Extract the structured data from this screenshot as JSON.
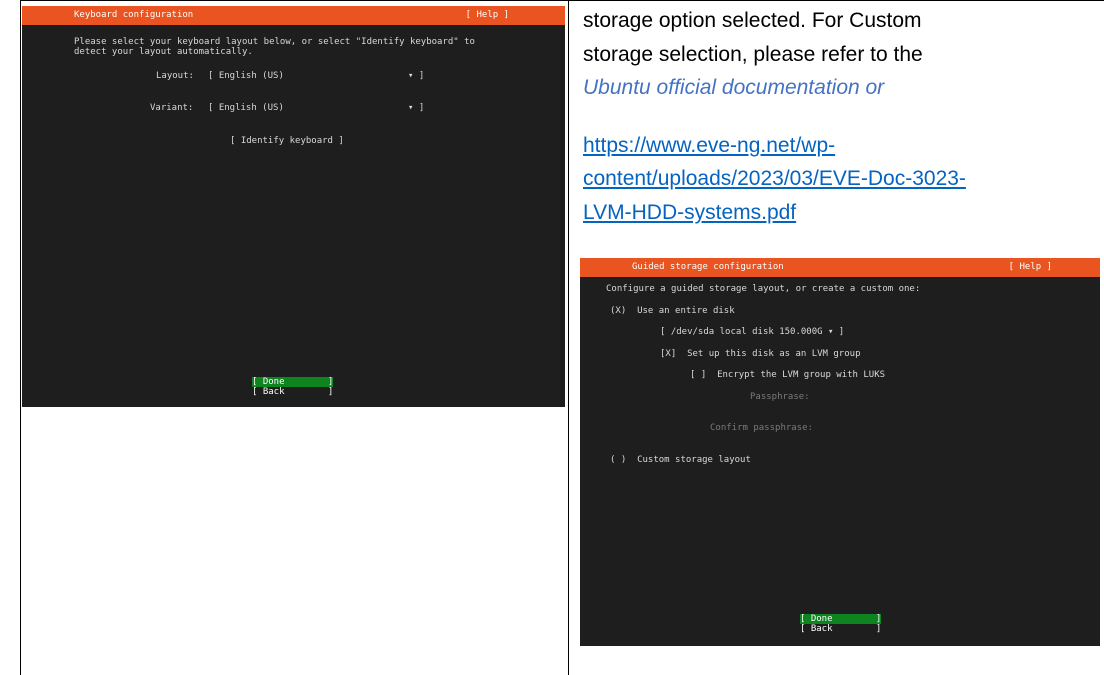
{
  "keyboard_screen": {
    "title": "Keyboard configuration",
    "help": "[ Help ]",
    "intro_line1": "Please select your keyboard layout below, or select \"Identify keyboard\" to",
    "intro_line2": "detect your layout automatically.",
    "layout_label": "Layout:",
    "layout_value": "[ English (US)",
    "layout_arrow": "▾ ]",
    "variant_label": "Variant:",
    "variant_value": "[ English (US)",
    "variant_arrow": "▾ ]",
    "identify_button": "[ Identify keyboard ]",
    "done_button": "[ Done        ]",
    "back_button": "[ Back        ]"
  },
  "doc_text": {
    "line1": "storage option selected. For Custom",
    "line2": "storage selection, please refer to the",
    "line3": "Ubuntu official documentation or",
    "link_line1": "https://www.eve-ng.net/wp-",
    "link_line2": "content/uploads/2023/03/EVE-Doc-3023-",
    "link_line3": "LVM-HDD-systems.pdf"
  },
  "storage_screen": {
    "title": "Guided storage configuration",
    "help": "[ Help ]",
    "intro": "Configure a guided storage layout, or create a custom one:",
    "entire_disk_option": "(X)  Use an entire disk",
    "disk_select": "[ /dev/sda local disk 150.000G ▾ ]",
    "lvm_checkbox": "[X]  Set up this disk as an LVM group",
    "encrypt_checkbox": "[ ]  Encrypt the LVM group with LUKS",
    "passphrase_label": "Passphrase:",
    "confirm_label": "Confirm passphrase:",
    "custom_option": "( )  Custom storage layout",
    "done_button": "[ Done        ]",
    "back_button": "[ Back        ]"
  },
  "colors": {
    "title_bar": "#e95420",
    "terminal_bg": "#1e1e1e",
    "selected_button": "#0e8420",
    "link": "#0563c1",
    "italic_text": "#4472c4"
  }
}
